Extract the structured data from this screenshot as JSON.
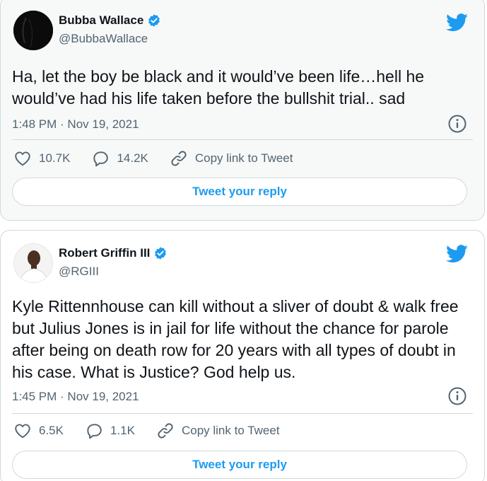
{
  "colors": {
    "brand_blue": "#1d9bf0",
    "text": "#0f1419",
    "muted": "#536471",
    "border": "#cfd9de"
  },
  "tweets": [
    {
      "name": "Bubba Wallace",
      "handle": "@BubbaWallace",
      "verified": true,
      "text": "Ha, let the boy be black and it would’ve been life…hell he would’ve had his life taken before the bullshit trial.. sad",
      "time": "1:48 PM · Nov 19, 2021",
      "likes": "10.7K",
      "replies": "14.2K",
      "copy_link_label": "Copy link to Tweet",
      "reply_button_label": "Tweet your reply",
      "icons": [
        "twitter-bird-icon",
        "verified-badge-icon",
        "info-icon",
        "heart-icon",
        "reply-bubble-icon",
        "link-icon"
      ]
    },
    {
      "name": "Robert Griffin III",
      "handle": "@RGIII",
      "verified": true,
      "text": "Kyle Rittennhouse can kill without a sliver of doubt & walk free but Julius Jones is in jail for life without the chance for parole after being on death row for 20 years with all types of doubt in his case. What is Justice? God help us.",
      "time": "1:45 PM · Nov 19, 2021",
      "likes": "6.5K",
      "replies": "1.1K",
      "copy_link_label": "Copy link to Tweet",
      "reply_button_label": "Tweet your reply",
      "icons": [
        "twitter-bird-icon",
        "verified-badge-icon",
        "info-icon",
        "heart-icon",
        "reply-bubble-icon",
        "link-icon"
      ]
    }
  ]
}
